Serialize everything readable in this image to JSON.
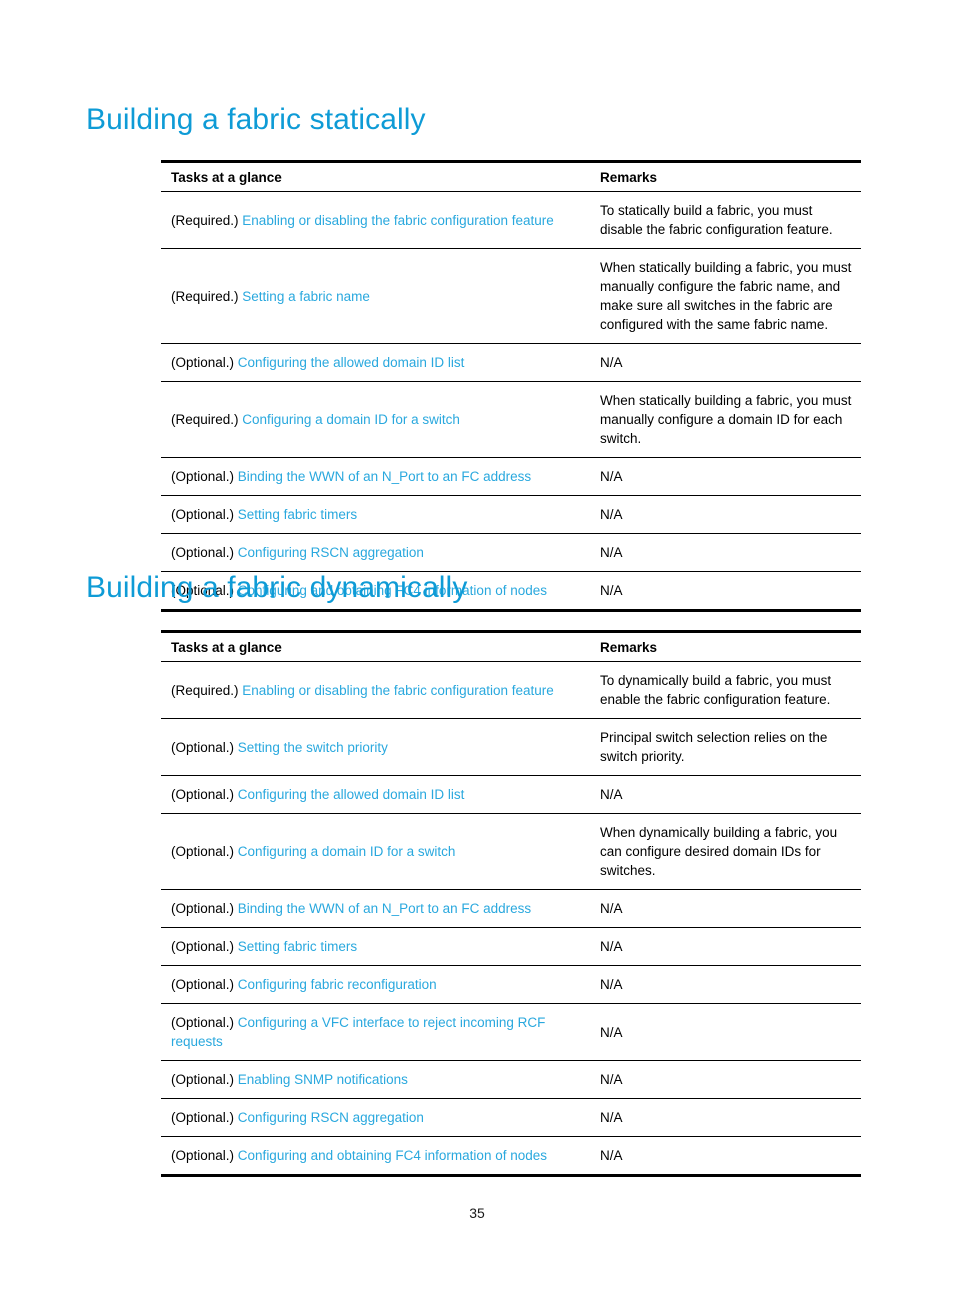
{
  "page": {
    "number": "35",
    "accent_color": "#0e9bd6",
    "link_color": "#29a8de",
    "background_color": "#ffffff"
  },
  "sections": [
    {
      "heading": "Building a fabric statically",
      "table": {
        "headers": {
          "tasks": "Tasks at a glance",
          "remarks": "Remarks"
        },
        "rows": [
          {
            "requirement": "(Required.)",
            "task": "Enabling or disabling the fabric configuration feature",
            "remark": "To statically build a fabric, you must disable the fabric configuration feature."
          },
          {
            "requirement": "(Required.)",
            "task": "Setting a fabric name",
            "remark": "When statically building a fabric, you must manually configure the fabric name, and make sure all switches in the fabric are configured with the same fabric name."
          },
          {
            "requirement": "(Optional.)",
            "task": "Configuring the allowed domain ID list",
            "remark": "N/A"
          },
          {
            "requirement": "(Required.)",
            "task": "Configuring a domain ID for a switch",
            "remark": "When statically building a fabric, you must manually configure a domain ID for each switch."
          },
          {
            "requirement": "(Optional.)",
            "task": "Binding the WWN of an N_Port to an FC address",
            "remark": "N/A"
          },
          {
            "requirement": "(Optional.)",
            "task": "Setting fabric timers",
            "remark": "N/A"
          },
          {
            "requirement": "(Optional.)",
            "task": "Configuring RSCN aggregation",
            "remark": "N/A"
          },
          {
            "requirement": "(Optional.)",
            "task": "Configuring and obtaining FC4 information of nodes",
            "remark": "N/A"
          }
        ]
      }
    },
    {
      "heading": "Building a fabric dynamically",
      "table": {
        "headers": {
          "tasks": "Tasks at a glance",
          "remarks": "Remarks"
        },
        "rows": [
          {
            "requirement": "(Required.)",
            "task": "Enabling or disabling the fabric configuration feature",
            "remark": "To dynamically build a fabric, you must enable the fabric configuration feature."
          },
          {
            "requirement": "(Optional.)",
            "task": "Setting the switch priority",
            "remark": "Principal switch selection relies on the switch priority."
          },
          {
            "requirement": "(Optional.)",
            "task": "Configuring the allowed domain ID list",
            "remark": "N/A"
          },
          {
            "requirement": "(Optional.)",
            "task": "Configuring a domain ID for a switch",
            "remark": "When dynamically building a fabric, you can configure desired domain IDs for switches."
          },
          {
            "requirement": "(Optional.)",
            "task": "Binding the WWN of an N_Port to an FC address",
            "remark": "N/A"
          },
          {
            "requirement": "(Optional.)",
            "task": "Setting fabric timers",
            "remark": "N/A"
          },
          {
            "requirement": "(Optional.)",
            "task": "Configuring fabric reconfiguration",
            "remark": "N/A"
          },
          {
            "requirement": "(Optional.)",
            "task": "Configuring a VFC interface to reject incoming RCF requests",
            "remark": "N/A"
          },
          {
            "requirement": "(Optional.)",
            "task": "Enabling SNMP notifications",
            "remark": "N/A"
          },
          {
            "requirement": "(Optional.)",
            "task": "Configuring RSCN aggregation",
            "remark": "N/A"
          },
          {
            "requirement": "(Optional.)",
            "task": "Configuring and obtaining FC4 information of nodes",
            "remark": "N/A"
          }
        ]
      }
    }
  ]
}
